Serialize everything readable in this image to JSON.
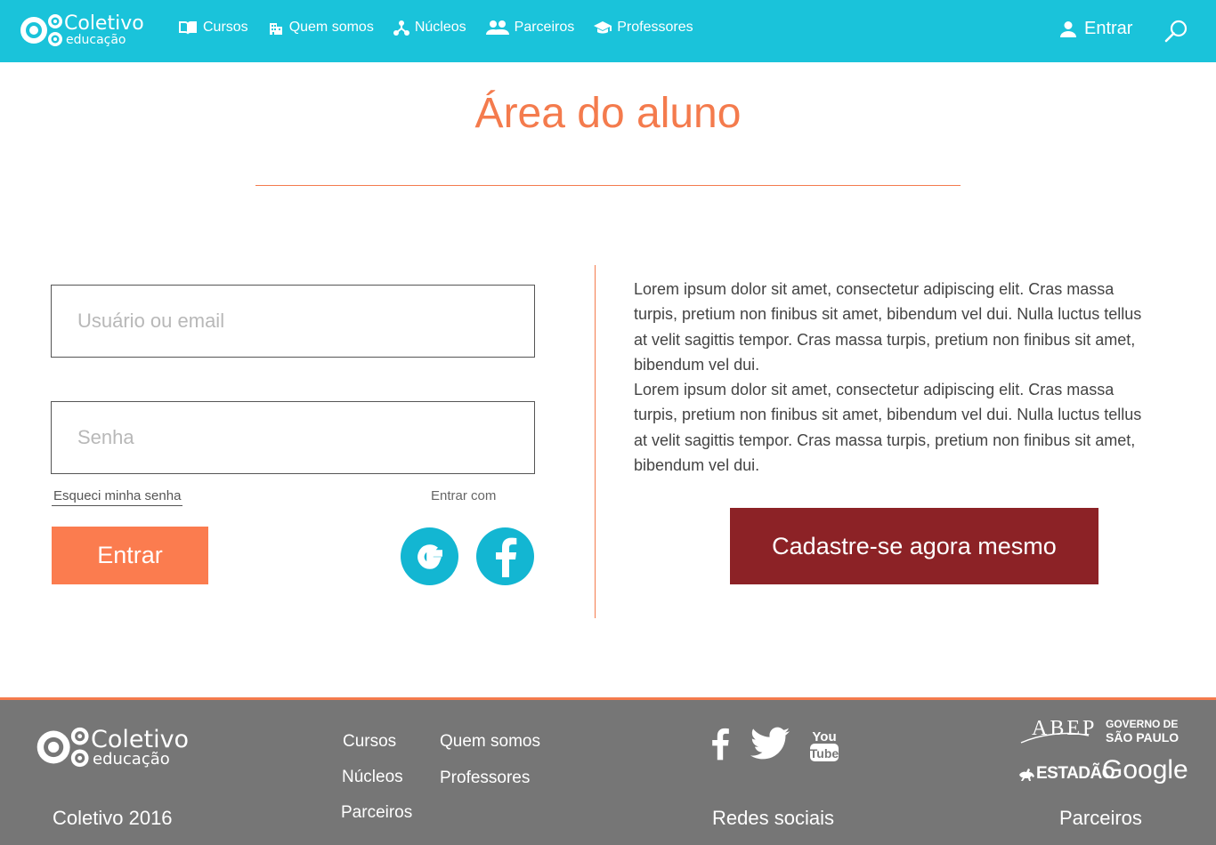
{
  "brand": {
    "name": "Coletivo",
    "tagline": "educação"
  },
  "nav": {
    "items": [
      {
        "label": "Cursos",
        "icon": "book-icon"
      },
      {
        "label": "Quem somos",
        "icon": "building-icon"
      },
      {
        "label": "Núcleos",
        "icon": "hub-icon"
      },
      {
        "label": "Parceiros",
        "icon": "people-icon"
      },
      {
        "label": "Professores",
        "icon": "graduation-cap-icon"
      }
    ],
    "login_label": "Entrar",
    "search_icon": "search-icon"
  },
  "page": {
    "title": "Área do aluno"
  },
  "login_form": {
    "username_placeholder": "Usuário ou email",
    "password_placeholder": "Senha",
    "forgot_label": "Esqueci minha senha",
    "enter_with_label": "Entrar com",
    "submit_label": "Entrar",
    "social": [
      "google-icon",
      "facebook-icon"
    ]
  },
  "info": {
    "paragraphs": [
      "Lorem ipsum dolor sit amet, consectetur adipiscing elit. Cras massa turpis, pretium non finibus sit amet, bibendum vel dui. Nulla luctus tellus at velit sagittis tempor.  Cras massa turpis, pretium non finibus sit amet, bibendum vel dui.",
      "Lorem ipsum dolor sit amet, consectetur adipiscing elit. Cras massa turpis, pretium non finibus sit amet, bibendum vel dui. Nulla luctus tellus at velit sagittis tempor.  Cras massa turpis, pretium non finibus sit amet, bibendum vel dui."
    ],
    "register_label": "Cadastre-se agora mesmo"
  },
  "footer": {
    "copyright": "Coletivo 2016",
    "links": {
      "col1": [
        "Cursos",
        "Núcleos",
        "Parceiros"
      ],
      "col2": [
        "Quem somos",
        "Professores"
      ]
    },
    "social_label": "Redes sociais",
    "social_icons": [
      "facebook-icon",
      "twitter-icon",
      "youtube-icon"
    ],
    "partners_label": "Parceiros",
    "partners": {
      "abep": "ABEP",
      "governo_line1": "GOVERNO DE",
      "governo_line2": "SÃO PAULO",
      "estadao": "ESTADÃO",
      "google": "Google"
    }
  },
  "colors": {
    "header": "#1ac3da",
    "accent": "#f47b4d",
    "enter_button": "#fb7c4f",
    "register_button": "#8c2226",
    "footer": "#767676"
  }
}
